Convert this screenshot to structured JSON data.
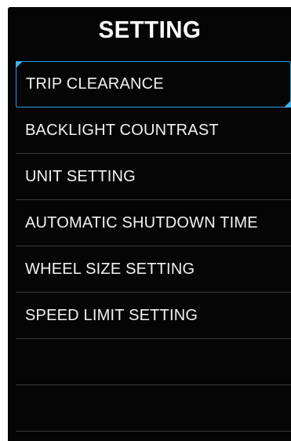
{
  "screen": {
    "title": "SETTING",
    "accent_color": "#2a9fd8"
  },
  "menu": {
    "items": [
      {
        "label": "TRIP CLEARANCE",
        "selected": true
      },
      {
        "label": "BACKLIGHT COUNTRAST",
        "selected": false
      },
      {
        "label": "UNIT SETTING",
        "selected": false
      },
      {
        "label": "AUTOMATIC SHUTDOWN TIME",
        "selected": false
      },
      {
        "label": "WHEEL SIZE SETTING",
        "selected": false
      },
      {
        "label": "SPEED LIMIT SETTING",
        "selected": false
      }
    ]
  }
}
